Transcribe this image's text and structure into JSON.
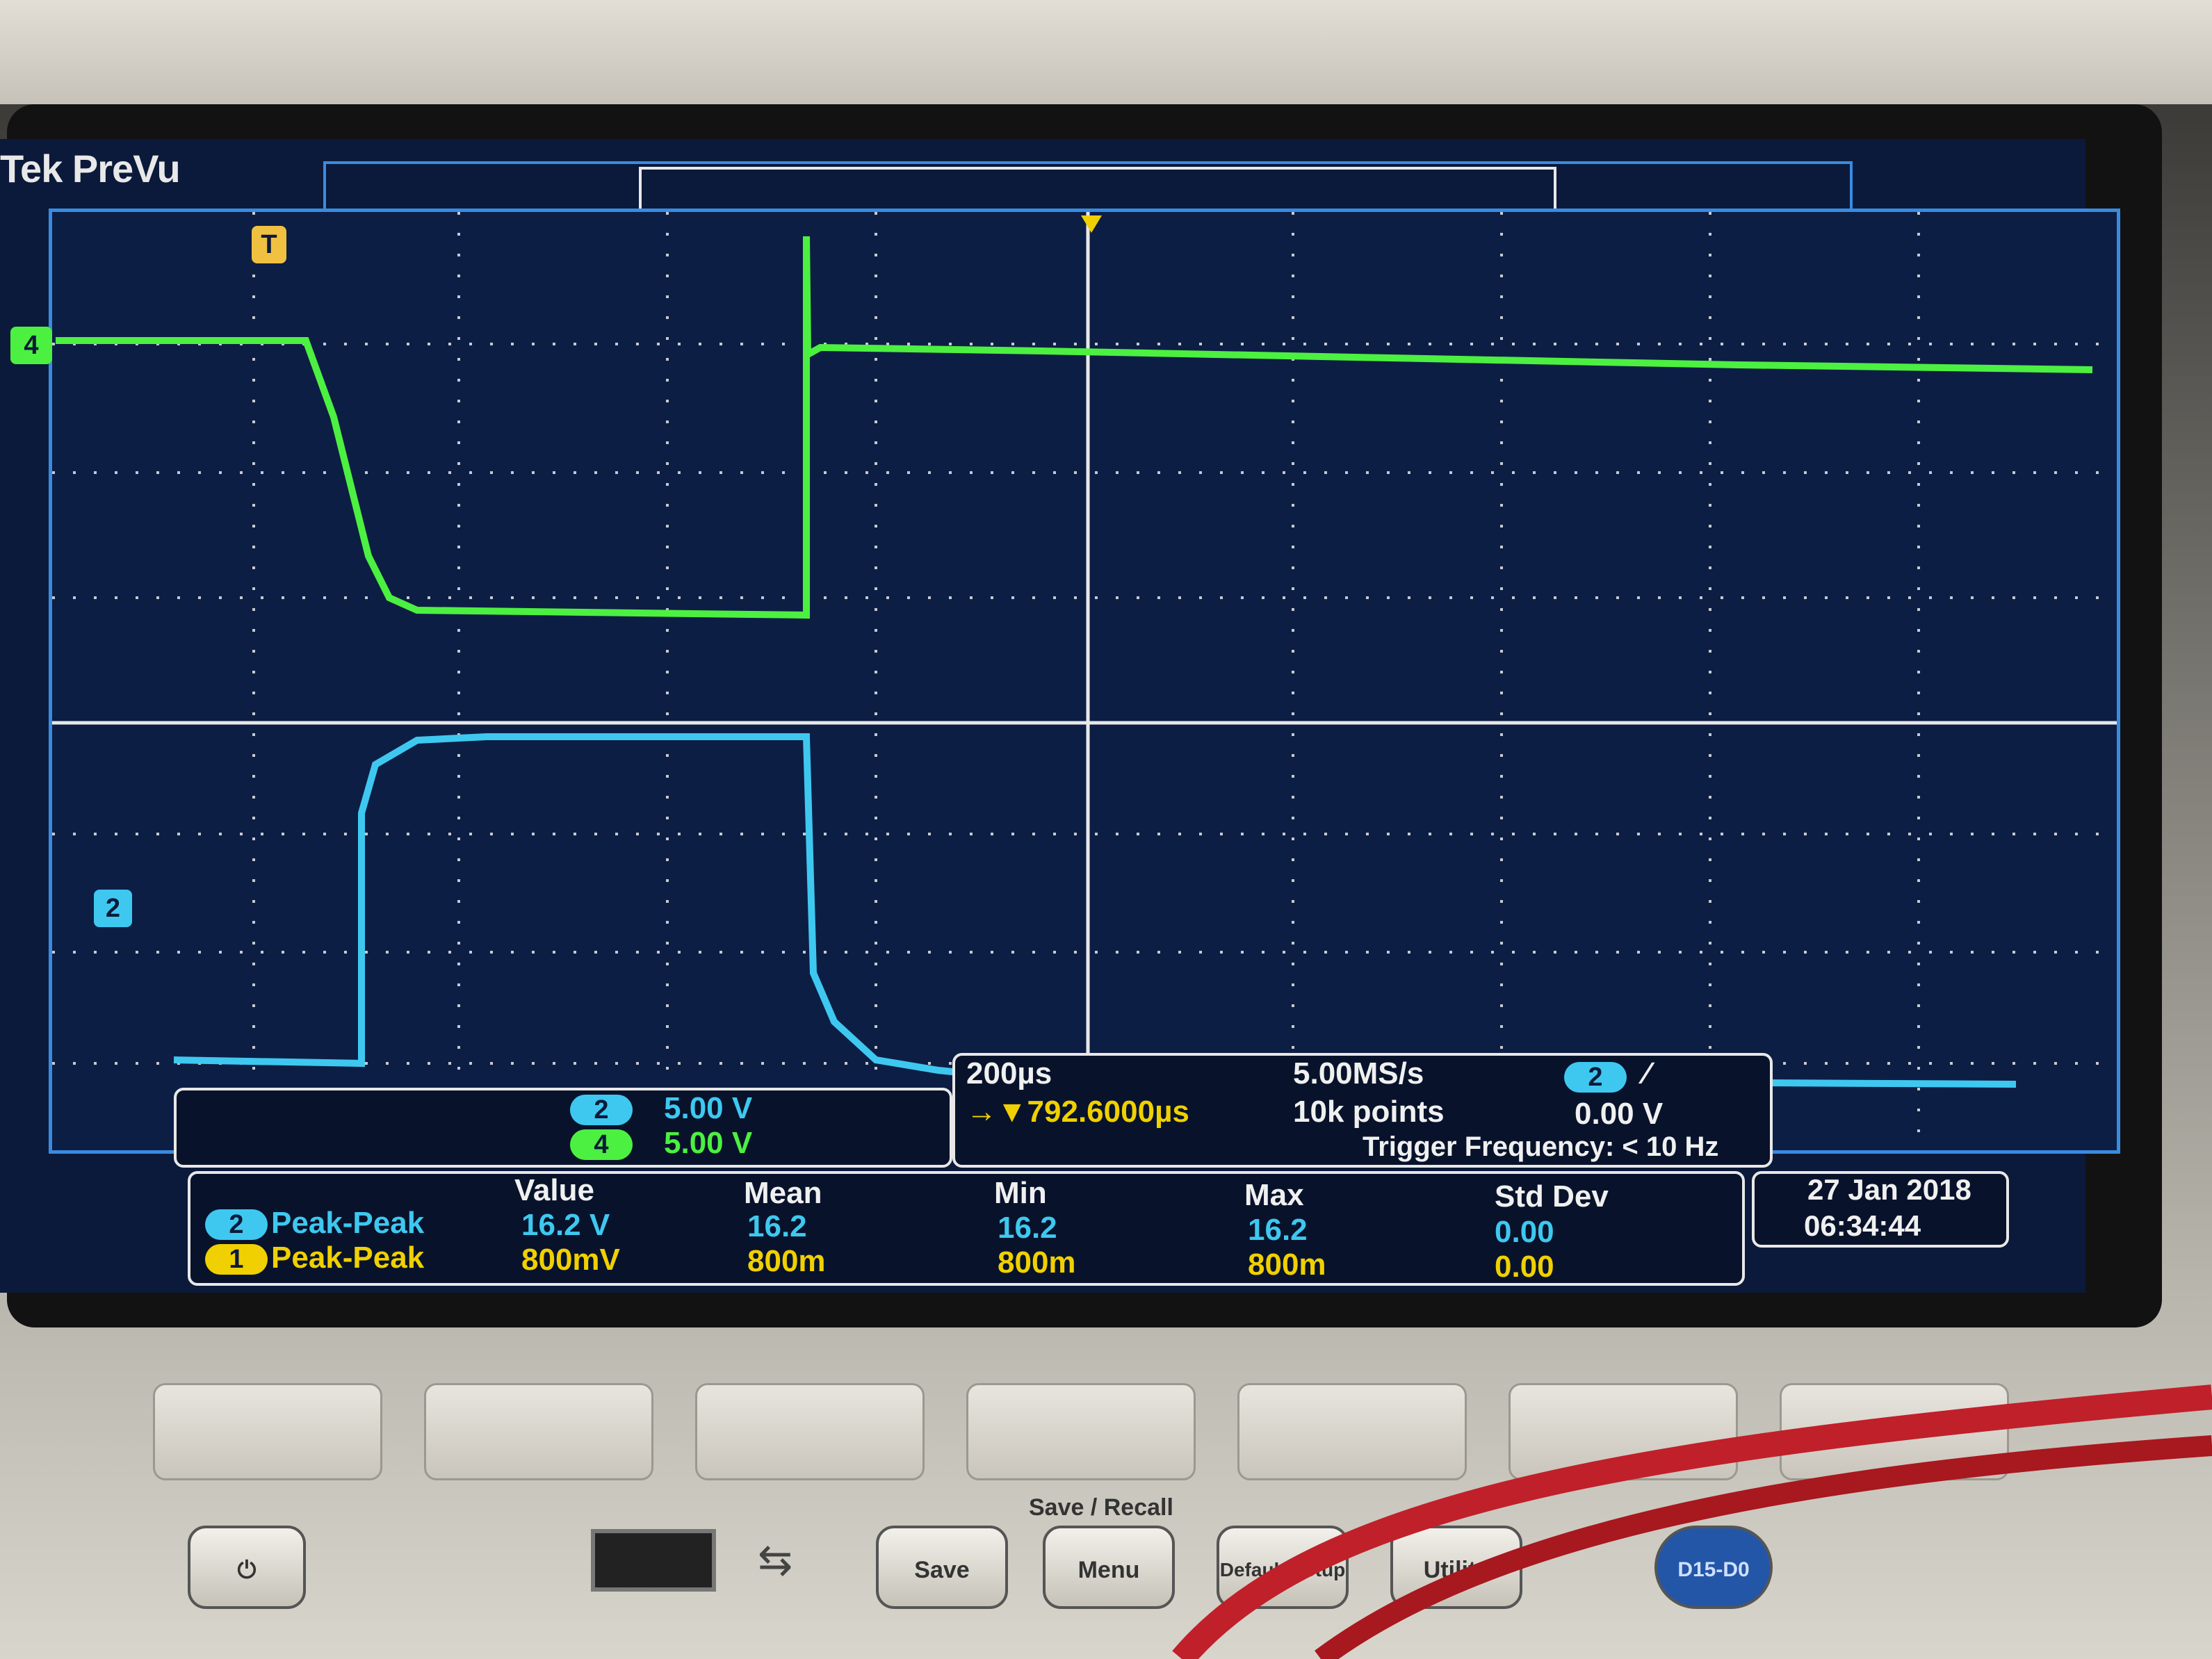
{
  "brand": "Tek PreVu",
  "channels": [
    {
      "id": "2",
      "scale": "5.00 V",
      "color": "#3ec8f0"
    },
    {
      "id": "4",
      "scale": "5.00 V",
      "color": "#4cf040"
    }
  ],
  "trigger_marker": "T",
  "timebase": {
    "horizontal_scale": "200µs",
    "position": "→▼792.6000µs",
    "sample_rate": "5.00MS/s",
    "record_length": "10k points",
    "trigger_channel": "2",
    "trigger_level": "0.00 V",
    "trigger_frequency": "Trigger Frequency: < 10 Hz"
  },
  "measurements": {
    "headers": [
      "Value",
      "Mean",
      "Min",
      "Max",
      "Std Dev"
    ],
    "rows": [
      {
        "channel": "2",
        "type": "Peak-Peak",
        "value": "16.2 V",
        "mean": "16.2",
        "min": "16.2",
        "max": "16.2",
        "std_dev": "0.00",
        "color": "#3ec8f0"
      },
      {
        "channel": "1",
        "type": "Peak-Peak",
        "value": "800mV",
        "mean": "800m",
        "min": "800m",
        "max": "800m",
        "std_dev": "0.00",
        "color": "#f0d000"
      }
    ]
  },
  "datetime": {
    "date": "27 Jan 2018",
    "time": "06:34:44"
  },
  "front_panel": {
    "save_recall_label": "Save / Recall",
    "buttons": [
      "Save",
      "Menu",
      "Default Setup",
      "Utility"
    ],
    "digital_button": "D15-D0"
  },
  "colors": {
    "screen_bg": "#0d1e45",
    "grid": "#e8e8e8",
    "border": "#3a8be0"
  }
}
